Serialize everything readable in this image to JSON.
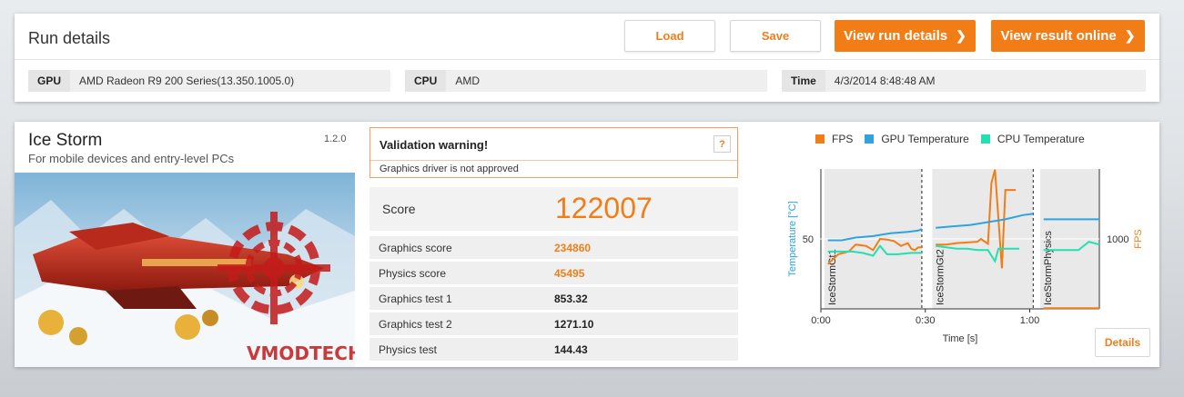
{
  "run": {
    "title": "Run details",
    "load_label": "Load",
    "save_label": "Save",
    "view_run_label": "View run details",
    "view_online_label": "View result online",
    "gpu_key": "GPU",
    "gpu_value": "AMD Radeon R9 200 Series(13.350.1005.0)",
    "cpu_key": "CPU",
    "cpu_value": "AMD",
    "time_key": "Time",
    "time_value": "4/3/2014 8:48:48 AM"
  },
  "benchmark": {
    "title": "Ice Storm",
    "version": "1.2.0",
    "subtitle": "For mobile devices and entry-level PCs",
    "watermark": "VMODTECH.COM"
  },
  "validation": {
    "title": "Validation warning!",
    "help": "?",
    "message": "Graphics driver is not approved"
  },
  "score": {
    "label": "Score",
    "value": "122007"
  },
  "results": [
    {
      "label": "Graphics score",
      "value": "234860",
      "highlight": true
    },
    {
      "label": "Physics score",
      "value": "45495",
      "highlight": true
    },
    {
      "label": "Graphics test 1",
      "value": "853.32",
      "highlight": false
    },
    {
      "label": "Graphics test 2",
      "value": "1271.10",
      "highlight": false
    },
    {
      "label": "Physics test",
      "value": "144.43",
      "highlight": false
    }
  ],
  "details_label": "Details",
  "colors": {
    "accent": "#f27d17",
    "fps": "#f27d17",
    "gpu_temp": "#2ea3e0",
    "cpu_temp": "#23e0b0"
  },
  "chart_data": {
    "type": "line",
    "legend": [
      "FPS",
      "GPU Temperature",
      "CPU Temperature"
    ],
    "legend_position": "top",
    "xlabel": "Time [s]",
    "ylabel_left": "Temperature [°C]",
    "ylabel_right": "FPS",
    "x_ticks": [
      "0:00",
      "0:30",
      "1:00"
    ],
    "y_left_ticks": [
      "50"
    ],
    "y_right_ticks": [
      "1000"
    ],
    "sections": [
      "IceStormGt1",
      "IceStormGt2",
      "IceStormPhysics"
    ],
    "section_bounds": [
      [
        1,
        29
      ],
      [
        32,
        61
      ],
      [
        63,
        80
      ]
    ],
    "xlim": [
      0,
      80
    ],
    "ylim_left": [
      0,
      100
    ],
    "ylim_right": [
      0,
      2000
    ],
    "series": [
      {
        "name": "FPS",
        "axis": "right",
        "segments": [
          [
            [
              2,
              640
            ],
            [
              5,
              780
            ],
            [
              8,
              820
            ],
            [
              10,
              920
            ],
            [
              13,
              900
            ],
            [
              15,
              840
            ],
            [
              17,
              1000
            ],
            [
              19,
              990
            ],
            [
              21,
              970
            ],
            [
              23,
              900
            ],
            [
              25,
              940
            ],
            [
              26,
              860
            ],
            [
              27,
              840
            ],
            [
              28,
              880
            ],
            [
              29,
              880
            ]
          ],
          [
            [
              33,
              920
            ],
            [
              36,
              920
            ],
            [
              39,
              940
            ],
            [
              42,
              950
            ],
            [
              45,
              960
            ],
            [
              46,
              1000
            ],
            [
              48,
              930
            ],
            [
              49,
              1800
            ],
            [
              50,
              1990
            ],
            [
              52,
              580
            ],
            [
              53,
              1700
            ],
            [
              56,
              1700
            ]
          ],
          [
            [
              64,
              10
            ],
            [
              80,
              10
            ]
          ]
        ]
      },
      {
        "name": "GPU Temperature",
        "axis": "left",
        "segments": [
          [
            [
              2,
              49
            ],
            [
              6,
              49
            ],
            [
              10,
              51
            ],
            [
              15,
              52
            ],
            [
              20,
              54
            ],
            [
              25,
              55
            ],
            [
              28,
              56
            ],
            [
              29,
              57
            ]
          ],
          [
            [
              33,
              58
            ],
            [
              38,
              59
            ],
            [
              43,
              60
            ],
            [
              48,
              62
            ],
            [
              53,
              64
            ],
            [
              58,
              67
            ],
            [
              61,
              68
            ]
          ],
          [
            [
              64,
              64
            ],
            [
              80,
              64
            ]
          ]
        ]
      },
      {
        "name": "CPU Temperature",
        "axis": "left",
        "segments": [
          [
            [
              2,
              41
            ],
            [
              6,
              41
            ],
            [
              9,
              41
            ],
            [
              12,
              40
            ],
            [
              15,
              38
            ],
            [
              17,
              45
            ],
            [
              19,
              39
            ],
            [
              22,
              39
            ],
            [
              26,
              40
            ],
            [
              29,
              40
            ]
          ],
          [
            [
              33,
              45
            ],
            [
              36,
              44
            ],
            [
              39,
              43
            ],
            [
              42,
              43
            ],
            [
              45,
              42
            ],
            [
              48,
              42
            ],
            [
              50,
              34
            ],
            [
              51,
              43
            ],
            [
              54,
              43
            ],
            [
              57,
              43
            ]
          ],
          [
            [
              64,
              42
            ],
            [
              70,
              42
            ],
            [
              74,
              42
            ],
            [
              77,
              48
            ],
            [
              80,
              46
            ]
          ]
        ]
      }
    ]
  }
}
